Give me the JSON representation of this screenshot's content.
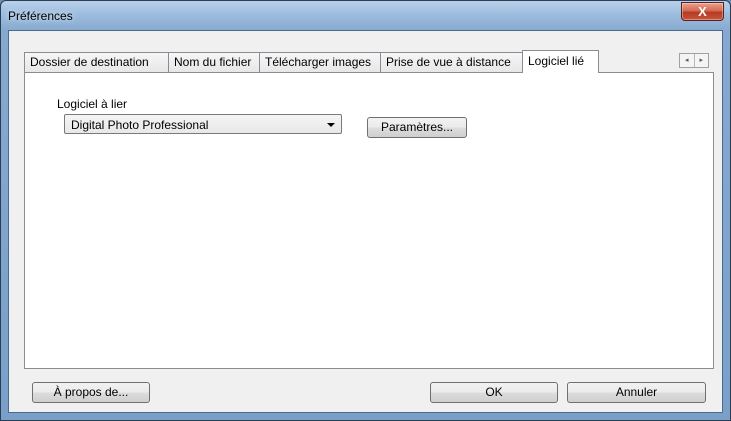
{
  "window": {
    "title": "Préférences",
    "close_symbol": "X"
  },
  "tabs": [
    {
      "label": "Dossier de destination",
      "active": false
    },
    {
      "label": "Nom du fichier",
      "active": false
    },
    {
      "label": "Télécharger images",
      "active": false
    },
    {
      "label": "Prise de vue à distance",
      "active": false
    },
    {
      "label": "Logiciel lié",
      "active": true
    }
  ],
  "tab_scroll": {
    "left": "◂",
    "right": "▸"
  },
  "panel": {
    "software_label": "Logiciel à lier",
    "software_selected": "Digital Photo Professional",
    "settings_button": "Paramètres..."
  },
  "footer": {
    "about_button": "À propos de...",
    "ok_button": "OK",
    "cancel_button": "Annuler"
  }
}
